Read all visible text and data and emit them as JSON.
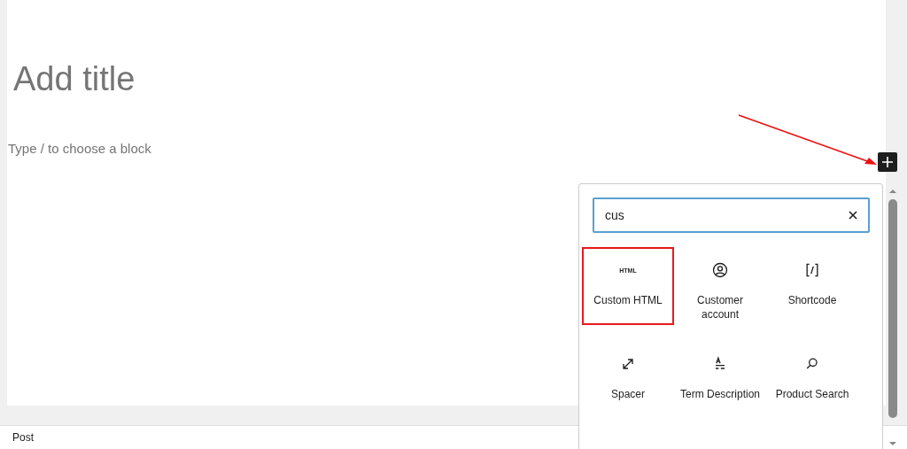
{
  "editor": {
    "title_placeholder": "Add title",
    "block_placeholder": "Type / to choose a block"
  },
  "inserter": {
    "search_value": "cus",
    "blocks": [
      {
        "kind": "html",
        "icon_text": "HTML",
        "label": "Custom HTML",
        "highlighted": true
      },
      {
        "kind": "person",
        "label": "Customer account",
        "highlighted": false
      },
      {
        "kind": "shortcode",
        "label": "Shortcode",
        "highlighted": false
      },
      {
        "kind": "spacer",
        "label": "Spacer",
        "highlighted": false
      },
      {
        "kind": "term",
        "label": "Term Description",
        "highlighted": false
      },
      {
        "kind": "search",
        "label": "Product Search",
        "highlighted": false
      }
    ]
  },
  "status_bar": {
    "label": "Post"
  }
}
